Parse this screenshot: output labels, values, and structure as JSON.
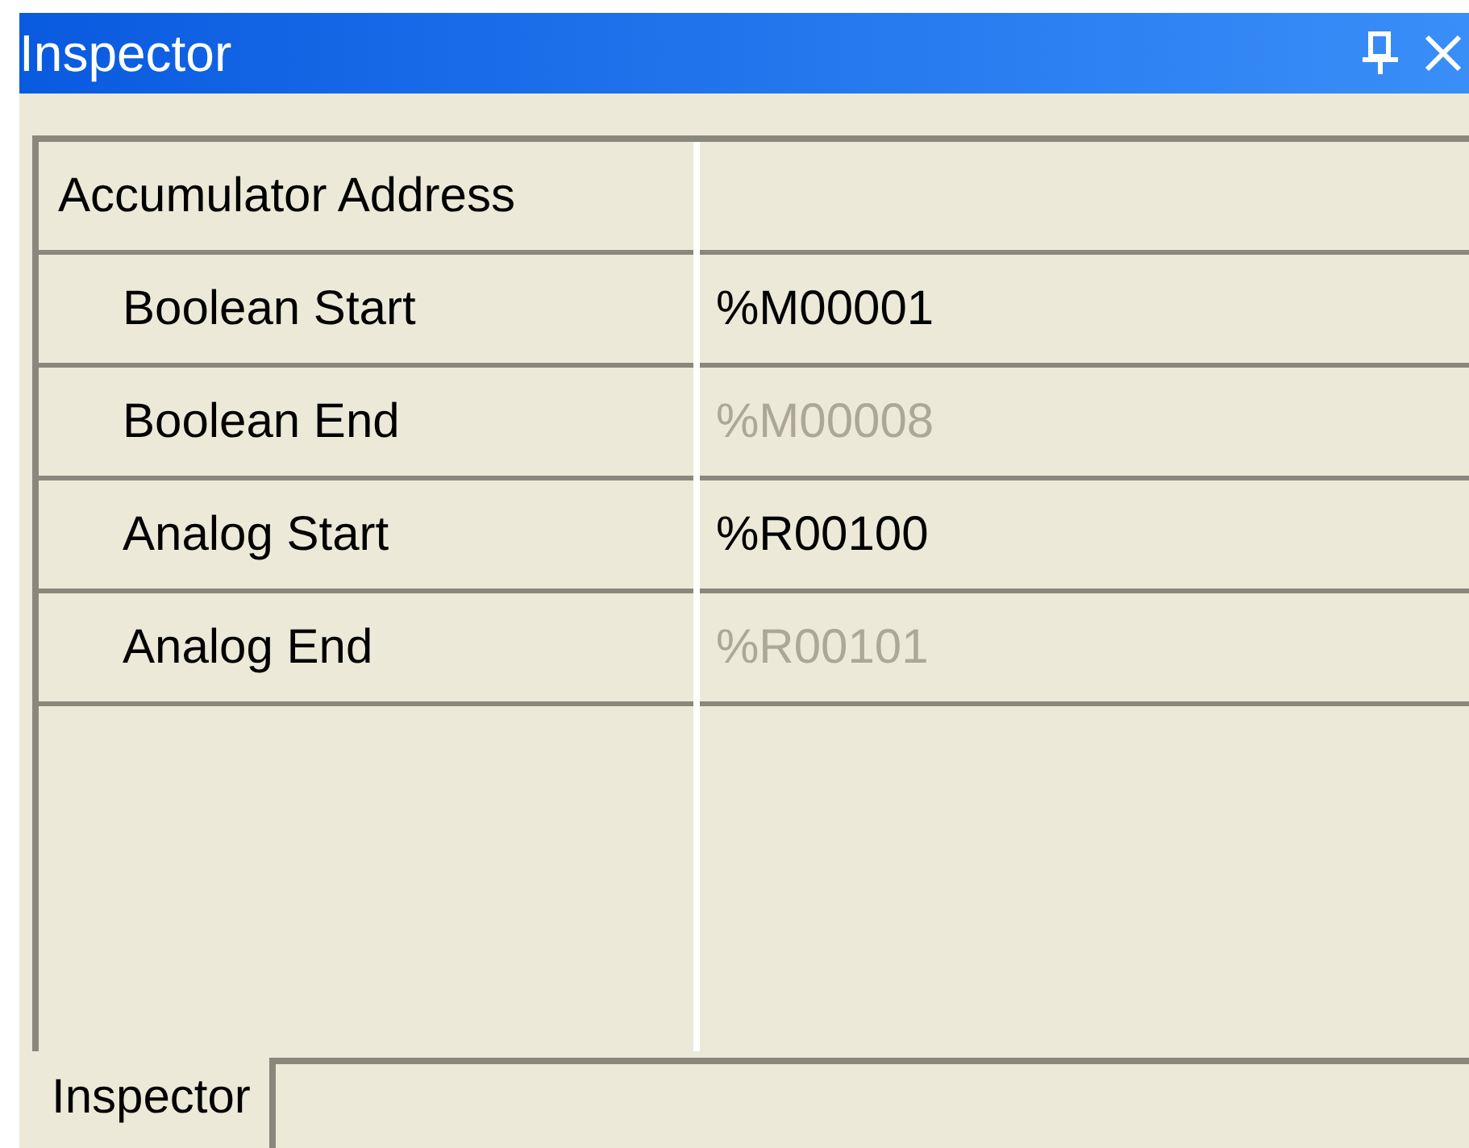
{
  "window": {
    "title": "Inspector",
    "buttons": [
      {
        "kind": "pin"
      },
      {
        "kind": "close"
      }
    ]
  },
  "properties": [
    {
      "kind": "category",
      "name": "Accumulator Address"
    },
    {
      "kind": "property",
      "name": "Boolean Start",
      "value": "%M00001",
      "disabled": false
    },
    {
      "kind": "property",
      "name": "Boolean End",
      "value": "%M00008",
      "disabled": true
    },
    {
      "kind": "property",
      "name": "Analog Start",
      "value": "%R00100",
      "disabled": false
    },
    {
      "kind": "property",
      "name": "Analog End",
      "value": "%R00101",
      "disabled": true
    }
  ],
  "tabs": [
    {
      "label": "Inspector",
      "selected": true
    }
  ]
}
